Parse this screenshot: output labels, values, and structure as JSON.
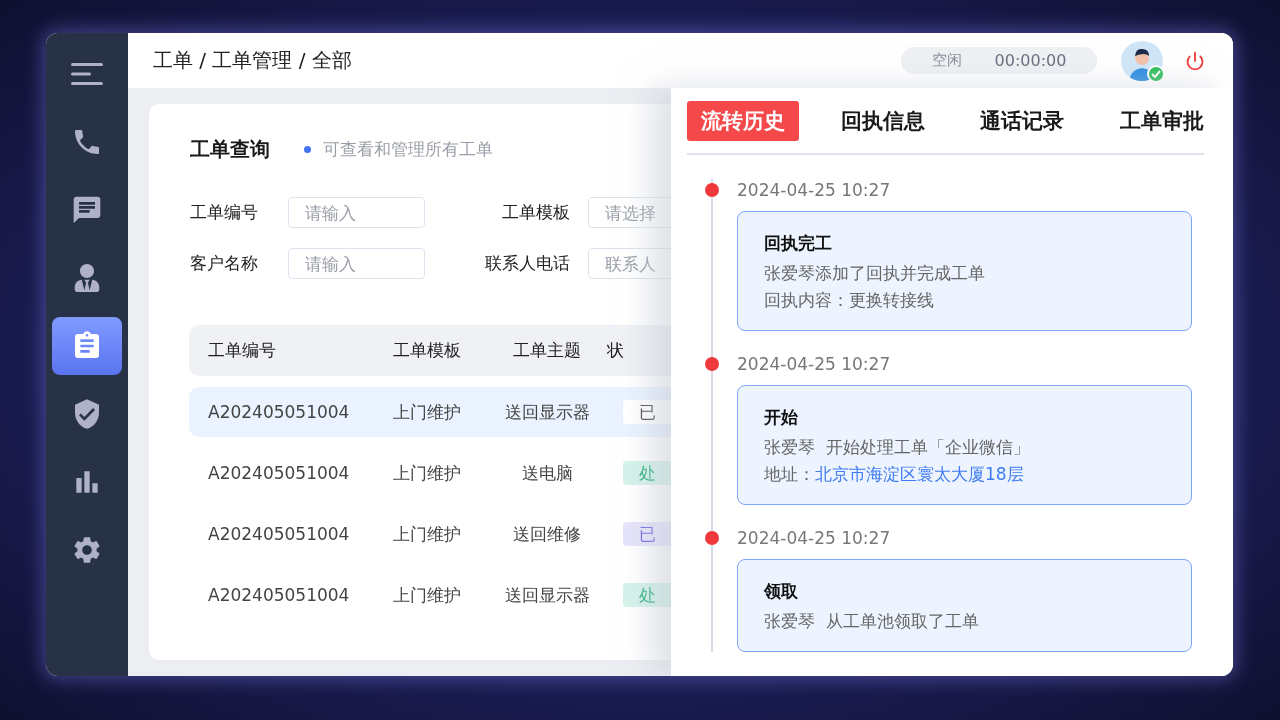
{
  "sidebar": {
    "items": [
      {
        "kind": "menu",
        "selected": false
      },
      {
        "kind": "phone",
        "selected": false
      },
      {
        "kind": "chat",
        "selected": false
      },
      {
        "kind": "user",
        "selected": false
      },
      {
        "kind": "clipboard",
        "selected": true
      },
      {
        "kind": "shield",
        "selected": false
      },
      {
        "kind": "chart",
        "selected": false
      },
      {
        "kind": "gear",
        "selected": false
      }
    ]
  },
  "header": {
    "breadcrumb": "工单 / 工单管理 / 全部",
    "status": {
      "label": "空闲",
      "timer": "00:00:00"
    },
    "user": {
      "online": true
    }
  },
  "query": {
    "title": "工单查询",
    "hint": "可查看和管理所有工单",
    "fields": [
      {
        "label": "工单编号",
        "placeholder": "请输入"
      },
      {
        "label": "工单模板",
        "placeholder": "请选择"
      },
      {
        "label": "客户名称",
        "placeholder": "请输入"
      },
      {
        "label": "联系人电话",
        "placeholder": "联系人"
      }
    ]
  },
  "table": {
    "columns": [
      "工单编号",
      "工单模板",
      "工单主题",
      "状"
    ],
    "rows": [
      {
        "cells": [
          "A202405051004",
          "上门维护",
          "送回显示器"
        ],
        "status": {
          "text": "已",
          "kind": "done"
        },
        "selected": true
      },
      {
        "cells": [
          "A202405051004",
          "上门维护",
          "送电脑"
        ],
        "status": {
          "text": "处",
          "kind": "processing"
        },
        "selected": false
      },
      {
        "cells": [
          "A202405051004",
          "上门维护",
          "送回维修"
        ],
        "status": {
          "text": "已",
          "kind": "accepted"
        },
        "selected": false
      },
      {
        "cells": [
          "A202405051004",
          "上门维护",
          "送回显示器"
        ],
        "status": {
          "text": "处",
          "kind": "processing"
        },
        "selected": false
      }
    ]
  },
  "drawer": {
    "tabs": [
      {
        "label": "流转历史",
        "selected": true
      },
      {
        "label": "回执信息",
        "selected": false
      },
      {
        "label": "通话记录",
        "selected": false
      },
      {
        "label": "工单审批",
        "selected": false
      }
    ],
    "timeline": [
      {
        "time": "2024-04-25 10:27",
        "title": "回执完工",
        "lines": [
          {
            "text": "张爱琴添加了回执并完成工单"
          },
          {
            "text": "回执内容：更换转接线"
          }
        ]
      },
      {
        "time": "2024-04-25 10:27",
        "title": "开始",
        "lines": [
          {
            "text": "张爱琴  开始处理工单「企业微信」"
          },
          {
            "text": "地址：",
            "link": "北京市海淀区寰太大厦18层"
          }
        ]
      },
      {
        "time": "2024-04-25 10:27",
        "title": "领取",
        "lines": [
          {
            "text": "张爱琴  从工单池领取了工单"
          }
        ]
      }
    ]
  }
}
